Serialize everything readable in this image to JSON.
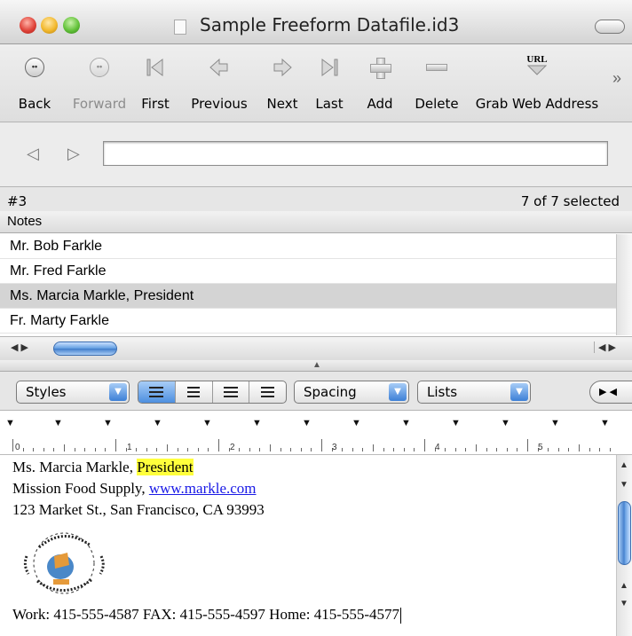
{
  "window": {
    "title": "Sample Freeform Datafile.id3"
  },
  "toolbar": {
    "items": [
      {
        "label": "Back",
        "icon": "back-circle-icon",
        "enabled": true
      },
      {
        "label": "Forward",
        "icon": "forward-circle-icon",
        "enabled": false
      },
      {
        "label": "First",
        "icon": "first-record-icon",
        "enabled": true
      },
      {
        "label": "Previous",
        "icon": "previous-arrow-icon",
        "enabled": true
      },
      {
        "label": "Next",
        "icon": "next-arrow-icon",
        "enabled": true
      },
      {
        "label": "Last",
        "icon": "last-record-icon",
        "enabled": true
      },
      {
        "label": "Add",
        "icon": "plus-icon",
        "enabled": true
      },
      {
        "label": "Delete",
        "icon": "minus-icon",
        "enabled": true
      },
      {
        "label": "Grab Web Address",
        "icon": "url-grab-icon",
        "enabled": true,
        "icon_text": "URL"
      }
    ],
    "more": "»"
  },
  "nav": {
    "field_value": ""
  },
  "record": {
    "number": "#3",
    "selection": "7 of 7 selected"
  },
  "list": {
    "column": "Notes",
    "rows": [
      {
        "text": "Mr. Bob Farkle",
        "selected": false
      },
      {
        "text": "Mr. Fred Farkle",
        "selected": false
      },
      {
        "text": "Ms. Marcia Markle, President",
        "selected": true
      },
      {
        "text": "Fr. Marty Farkle",
        "selected": false
      }
    ]
  },
  "format": {
    "styles": "Styles",
    "spacing": "Spacing",
    "lists": "Lists"
  },
  "ruler": {
    "numbers": [
      "0",
      "1",
      "2",
      "3",
      "4",
      "5"
    ]
  },
  "note": {
    "name": "Ms. Marcia Markle, ",
    "name_highlight": "President",
    "company": "Mission Food Supply, ",
    "link": "www.markle.com",
    "address": "123 Market St., San Francisco, CA  93993",
    "phones": "Work: 415-555-4587  FAX: 415-555-4597   Home: 415-555-4577"
  },
  "colors": {
    "highlight": "#ffff3c",
    "link": "#1a1ae6",
    "accent": "#3f7ccb",
    "selected_row": "#d4d4d4"
  }
}
